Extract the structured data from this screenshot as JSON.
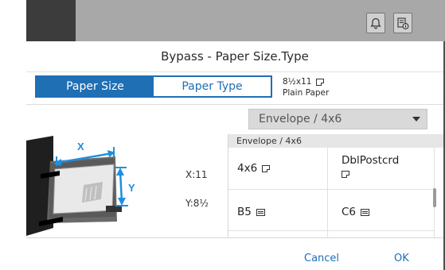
{
  "dialog": {
    "title": "Bypass - Paper Size.Type",
    "tabs": [
      {
        "label": "Paper Size",
        "active": true
      },
      {
        "label": "Paper Type",
        "active": false
      }
    ],
    "current": {
      "size": "8½x11",
      "type": "Plain Paper"
    },
    "dropdown": {
      "selected": "Envelope / 4x6"
    },
    "dimensions": {
      "x": "X:11",
      "y": "Y:8½"
    },
    "illustration": {
      "x_label": "X",
      "y_label": "Y"
    },
    "grid": {
      "header": "Envelope / 4x6",
      "items": [
        {
          "label": "4x6",
          "icon": "portrait-envelope-icon"
        },
        {
          "label": "DblPostcrd",
          "icon": "portrait-envelope-icon"
        },
        {
          "label": "B5",
          "icon": "landscape-envelope-icon"
        },
        {
          "label": "C6",
          "icon": "landscape-envelope-icon"
        }
      ]
    },
    "footer": {
      "cancel": "Cancel",
      "ok": "OK"
    }
  },
  "colors": {
    "accent": "#1f6fb5",
    "overlay": "#4f4f4f"
  }
}
